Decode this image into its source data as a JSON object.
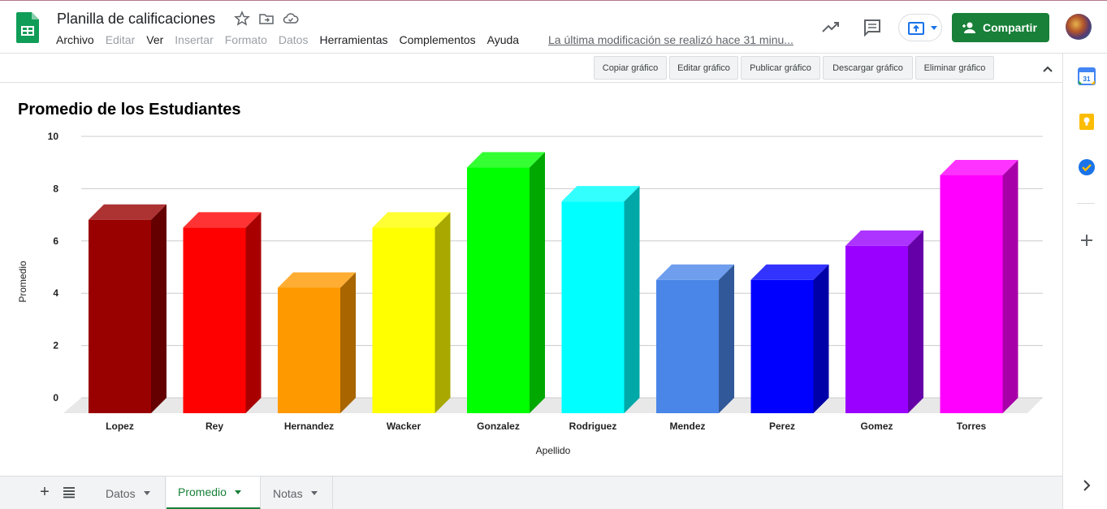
{
  "app": {
    "doc_title": "Planilla de calificaciones",
    "last_edit": "La última modificación se realizó hace 31 minu...",
    "share_label": "Compartir"
  },
  "menu": [
    {
      "label": "Archivo",
      "disabled": false
    },
    {
      "label": "Editar",
      "disabled": true
    },
    {
      "label": "Ver",
      "disabled": false
    },
    {
      "label": "Insertar",
      "disabled": true
    },
    {
      "label": "Formato",
      "disabled": true
    },
    {
      "label": "Datos",
      "disabled": true
    },
    {
      "label": "Herramientas",
      "disabled": false
    },
    {
      "label": "Complementos",
      "disabled": false
    },
    {
      "label": "Ayuda",
      "disabled": false
    }
  ],
  "chart_toolbar": {
    "copy": "Copiar gráfico",
    "edit": "Editar gráfico",
    "publish": "Publicar gráfico",
    "download": "Descargar gráfico",
    "delete": "Eliminar gráfico"
  },
  "sheet_tabs": [
    {
      "label": "Datos",
      "active": false
    },
    {
      "label": "Promedio",
      "active": true
    },
    {
      "label": "Notas",
      "active": false
    }
  ],
  "icons": {
    "header": [
      "star-icon",
      "move-folder-icon",
      "cloud-saved-icon",
      "trending-icon",
      "comment-icon",
      "present-icon",
      "add-person-icon"
    ],
    "side": [
      "calendar-icon",
      "keep-icon",
      "tasks-icon",
      "add-icon",
      "expand-right-icon"
    ]
  },
  "colors": {
    "brand_green": "#188038",
    "sheets_green": "#0f9d58"
  },
  "chart_data": {
    "type": "bar",
    "title": "Promedio de los Estudiantes",
    "xlabel": "Apellido",
    "ylabel": "Promedio",
    "ylim": [
      0,
      10
    ],
    "yticks": [
      "0",
      "2",
      "4",
      "6",
      "8",
      "10"
    ],
    "grid": true,
    "three_d": true,
    "categories": [
      "Lopez",
      "Rey",
      "Hernandez",
      "Wacker",
      "Gonzalez",
      "Rodriguez",
      "Mendez",
      "Perez",
      "Gomez",
      "Torres"
    ],
    "values": [
      7.4,
      7.1,
      4.8,
      7.1,
      9.4,
      8.1,
      5.1,
      5.1,
      6.4,
      9.1
    ],
    "bar_colors": [
      "#990000",
      "#ff0000",
      "#ff9900",
      "#ffff00",
      "#00ff00",
      "#00ffff",
      "#4a86e8",
      "#0000ff",
      "#9900ff",
      "#ff00ff"
    ]
  }
}
